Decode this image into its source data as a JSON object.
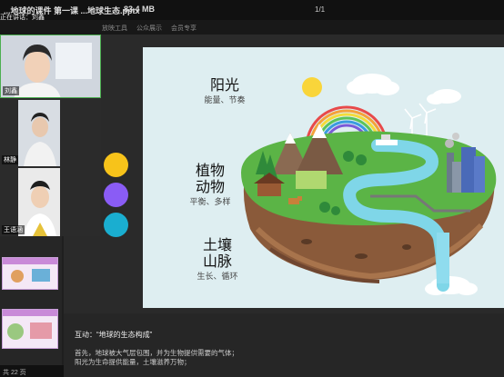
{
  "window": {
    "file_name": "...地球的课件 第一课 ...地球生态.pptx",
    "file_size": "83.4 MB",
    "page_indicator": "1/1"
  },
  "toolbar": {
    "items": [
      "正在讲话",
      "刘鑫",
      "放映工具",
      "公众展示",
      "会员专享"
    ]
  },
  "speaking": {
    "label": "正在讲话：刘鑫"
  },
  "videos": [
    {
      "name": "刘鑫"
    },
    {
      "name": "林静"
    },
    {
      "name": "王语涵"
    }
  ],
  "slide": {
    "sun": {
      "title": "阳光",
      "subtitle": "能量、节奏"
    },
    "life": {
      "title1": "植物",
      "title2": "动物",
      "subtitle": "平衡、多样"
    },
    "land": {
      "title1": "土壤",
      "title2": "山脉",
      "subtitle": "生长、循环"
    }
  },
  "notes": {
    "heading": "互动：“地球的生态构成”",
    "line1": "首先，地球被大气层包围，并为生物提供需要的气体；",
    "line2": "阳光为生命提供能量，土壤滋养万物；"
  },
  "status": {
    "pages": "共 22 页"
  },
  "colors": {
    "dot1": "#f7c31a",
    "dot2": "#8a5cf5",
    "dot3": "#1aaed0"
  }
}
